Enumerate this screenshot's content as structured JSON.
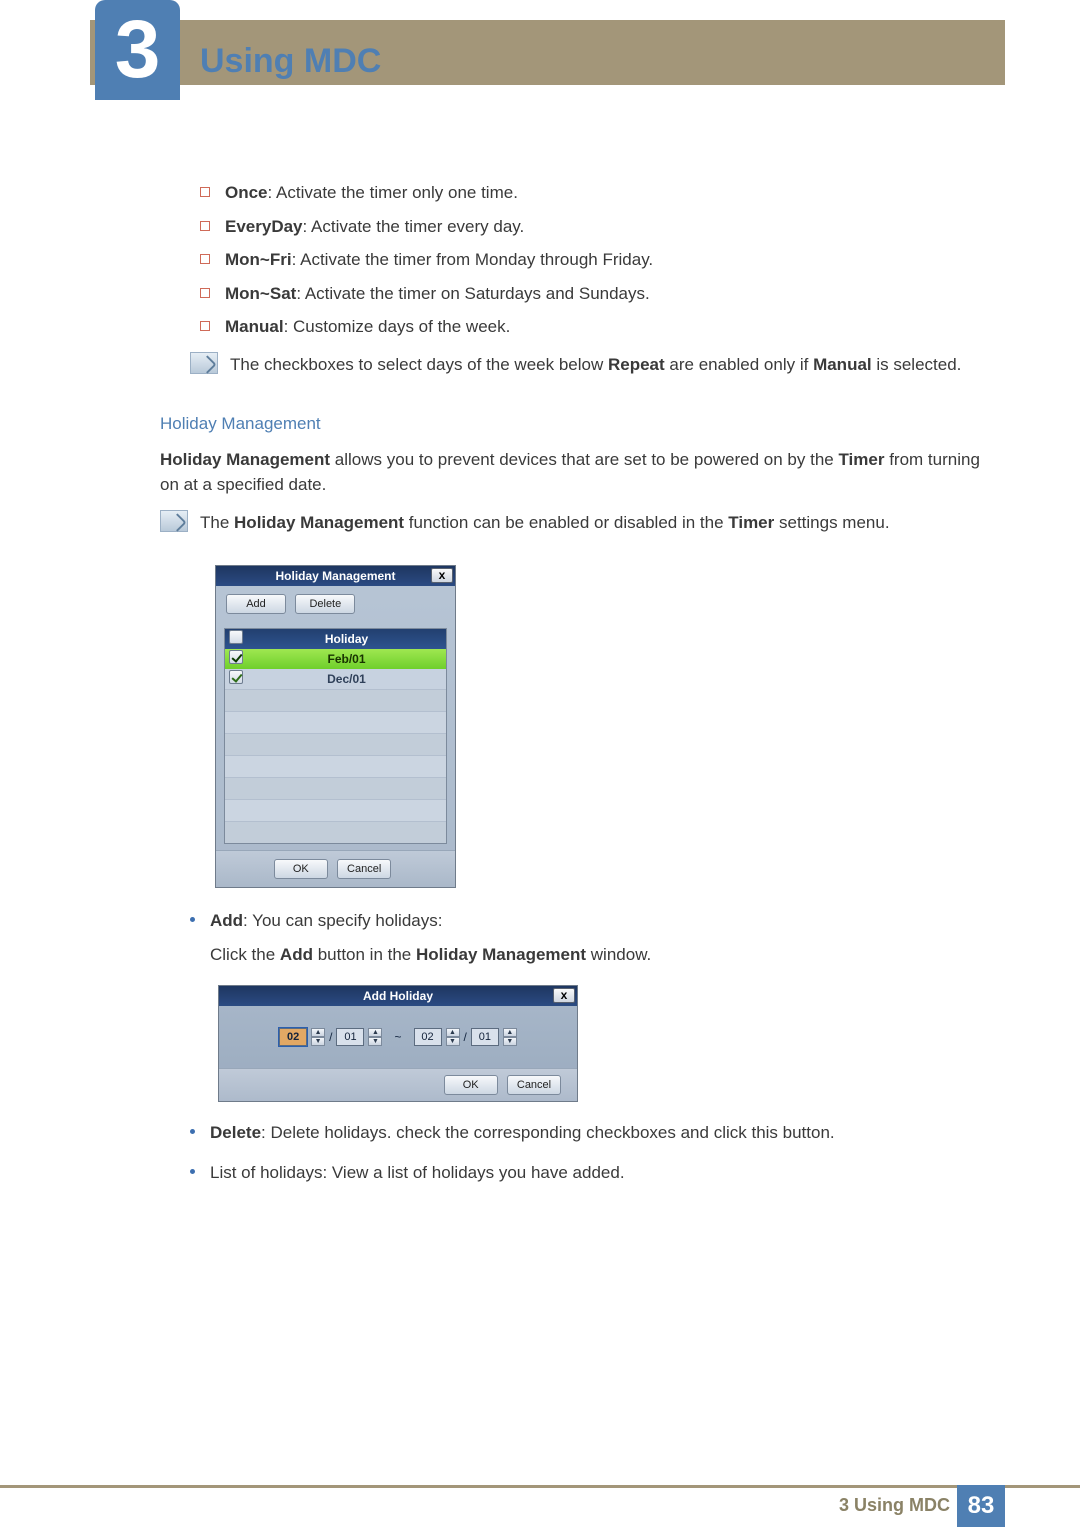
{
  "header": {
    "chapter_number": "3",
    "chapter_title": "Using MDC"
  },
  "timer_modes": [
    {
      "term": "Once",
      "desc": ": Activate the timer only one time."
    },
    {
      "term": "EveryDay",
      "desc": ": Activate the timer every day."
    },
    {
      "term": "Mon~Fri",
      "desc": ": Activate the timer from Monday through Friday."
    },
    {
      "term": "Mon~Sat",
      "desc": ": Activate the timer on Saturdays and Sundays."
    },
    {
      "term": "Manual",
      "desc": ": Customize days of the week."
    }
  ],
  "note1": {
    "pre": "The checkboxes to select days of the week below ",
    "b1": "Repeat",
    "mid": " are enabled only if ",
    "b2": "Manual",
    "post": " is selected."
  },
  "hm": {
    "heading": "Holiday Management",
    "para": {
      "b1": "Holiday Management",
      "mid": " allows you to prevent devices that are set to be powered on by the ",
      "b2": "Timer",
      "post": " from turning on at a specified date."
    }
  },
  "note2": {
    "pre": "The ",
    "b1": "Holiday Management",
    "mid": " function can be enabled or disabled in the ",
    "b2": "Timer",
    "post": " settings menu."
  },
  "hm_window": {
    "title": "Holiday Management",
    "close": "x",
    "add": "Add",
    "delete": "Delete",
    "col": "Holiday",
    "rows": [
      "Feb/01",
      "Dec/01"
    ],
    "ok": "OK",
    "cancel": "Cancel"
  },
  "bullets": {
    "add_term": "Add",
    "add_desc": ": You can specify holidays:",
    "add_sub": {
      "pre": "Click the ",
      "b1": "Add",
      "mid": " button in the ",
      "b2": "Holiday Management",
      "post": " window."
    },
    "delete_term": "Delete",
    "delete_desc": ": Delete holidays. check the corresponding checkboxes and click this button.",
    "list_desc": "List of holidays: View a list of holidays you have added."
  },
  "ah_window": {
    "title": "Add Holiday",
    "close": "x",
    "from_month": "02",
    "from_day": "01",
    "to_month": "02",
    "to_day": "01",
    "sep": "~",
    "slash": "/",
    "ok": "OK",
    "cancel": "Cancel"
  },
  "footer": {
    "label": "3 Using MDC",
    "page": "83"
  }
}
